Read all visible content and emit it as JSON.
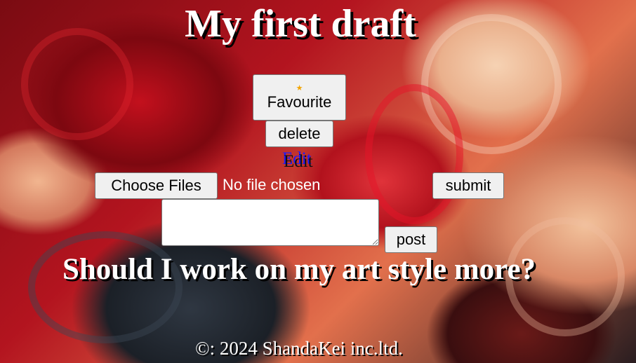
{
  "post": {
    "title": "My first draft",
    "question": "Should I work on my art style more?"
  },
  "actions": {
    "favourite_icon": "★",
    "favourite_label": "Favourite",
    "delete_label": "delete",
    "edit_link_label": "Edit",
    "edit_text_label": "Edit"
  },
  "upload": {
    "choose_label": "Choose Files",
    "status": "No file chosen",
    "submit_label": "submit"
  },
  "comment": {
    "value": "",
    "post_label": "post"
  },
  "footer": {
    "text": "©: 2024 ShandaKei inc.ltd."
  },
  "icons": {
    "favourite": "star-icon"
  }
}
